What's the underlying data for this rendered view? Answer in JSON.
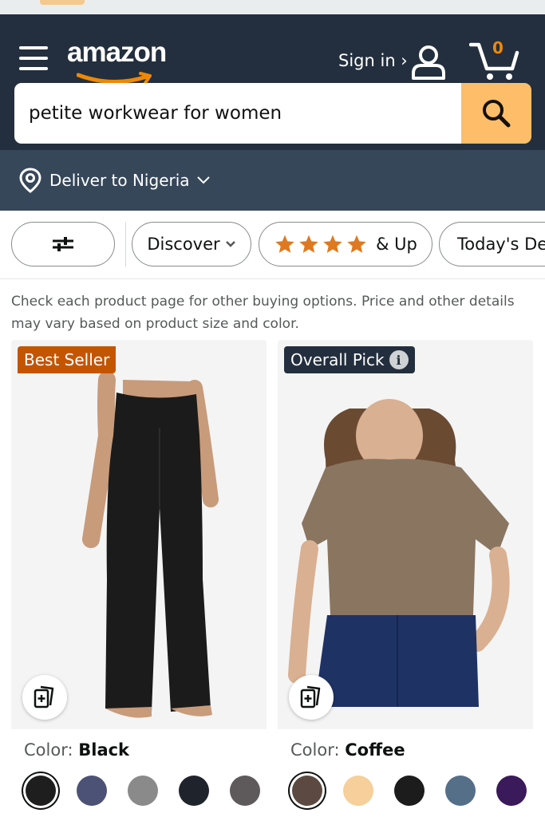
{
  "header": {
    "logo_text": "amazon",
    "signin_label": "Sign in ›",
    "cart_count": "0"
  },
  "search": {
    "query": "petite workwear for women"
  },
  "deliver": {
    "label": "Deliver to Nigeria"
  },
  "filters": {
    "discover_label": "Discover",
    "rating_label": "& Up",
    "rating_stars": 4,
    "todays_deals_label": "Today's De"
  },
  "notice": "Check each product page for other buying options. Price and other details may vary based on product size and color.",
  "products": [
    {
      "badge": "Best Seller",
      "color_label": "Color:",
      "color_value": "Black",
      "swatches": [
        "#1e1e1e",
        "#4c5275",
        "#8a8a8a",
        "#1f232b",
        "#5e5a5c"
      ]
    },
    {
      "badge": "Overall Pick",
      "color_label": "Color:",
      "color_value": "Coffee",
      "swatches": [
        "#5c4a42",
        "#f6cf9a",
        "#1c1c1c",
        "#566f88",
        "#3a1a5a"
      ]
    }
  ],
  "colors": {
    "header_bg": "#232f3e",
    "deliver_bg": "#37475a",
    "search_button": "#febd69",
    "best_seller_badge": "#c45500",
    "star": "#de7921"
  }
}
